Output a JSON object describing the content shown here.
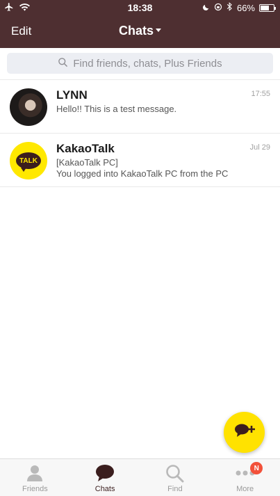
{
  "status_bar": {
    "time": "18:38",
    "battery": "66%",
    "battery_level": 0.66
  },
  "nav": {
    "edit_label": "Edit",
    "title": "Chats"
  },
  "search": {
    "placeholder": "Find friends, chats, Plus Friends"
  },
  "chats": [
    {
      "name": "LYNN",
      "time": "17:55",
      "preview": "Hello!! This is a test message."
    },
    {
      "name": "KakaoTalk",
      "time": "Jul 29",
      "preview_line1": "[KakaoTalk PC]",
      "preview_line2": "You logged into KakaoTalk PC from the PC",
      "avatar_text": "TALK"
    }
  ],
  "tabs": [
    {
      "label": "Friends",
      "icon": "person-icon"
    },
    {
      "label": "Chats",
      "icon": "chat-bubble-icon",
      "active": true
    },
    {
      "label": "Find",
      "icon": "search-icon"
    },
    {
      "label": "More",
      "icon": "more-dots-icon",
      "badge": "N"
    }
  ],
  "colors": {
    "header": "#4e2f31",
    "kakao_yellow": "#ffe200",
    "badge": "#f2513a"
  }
}
